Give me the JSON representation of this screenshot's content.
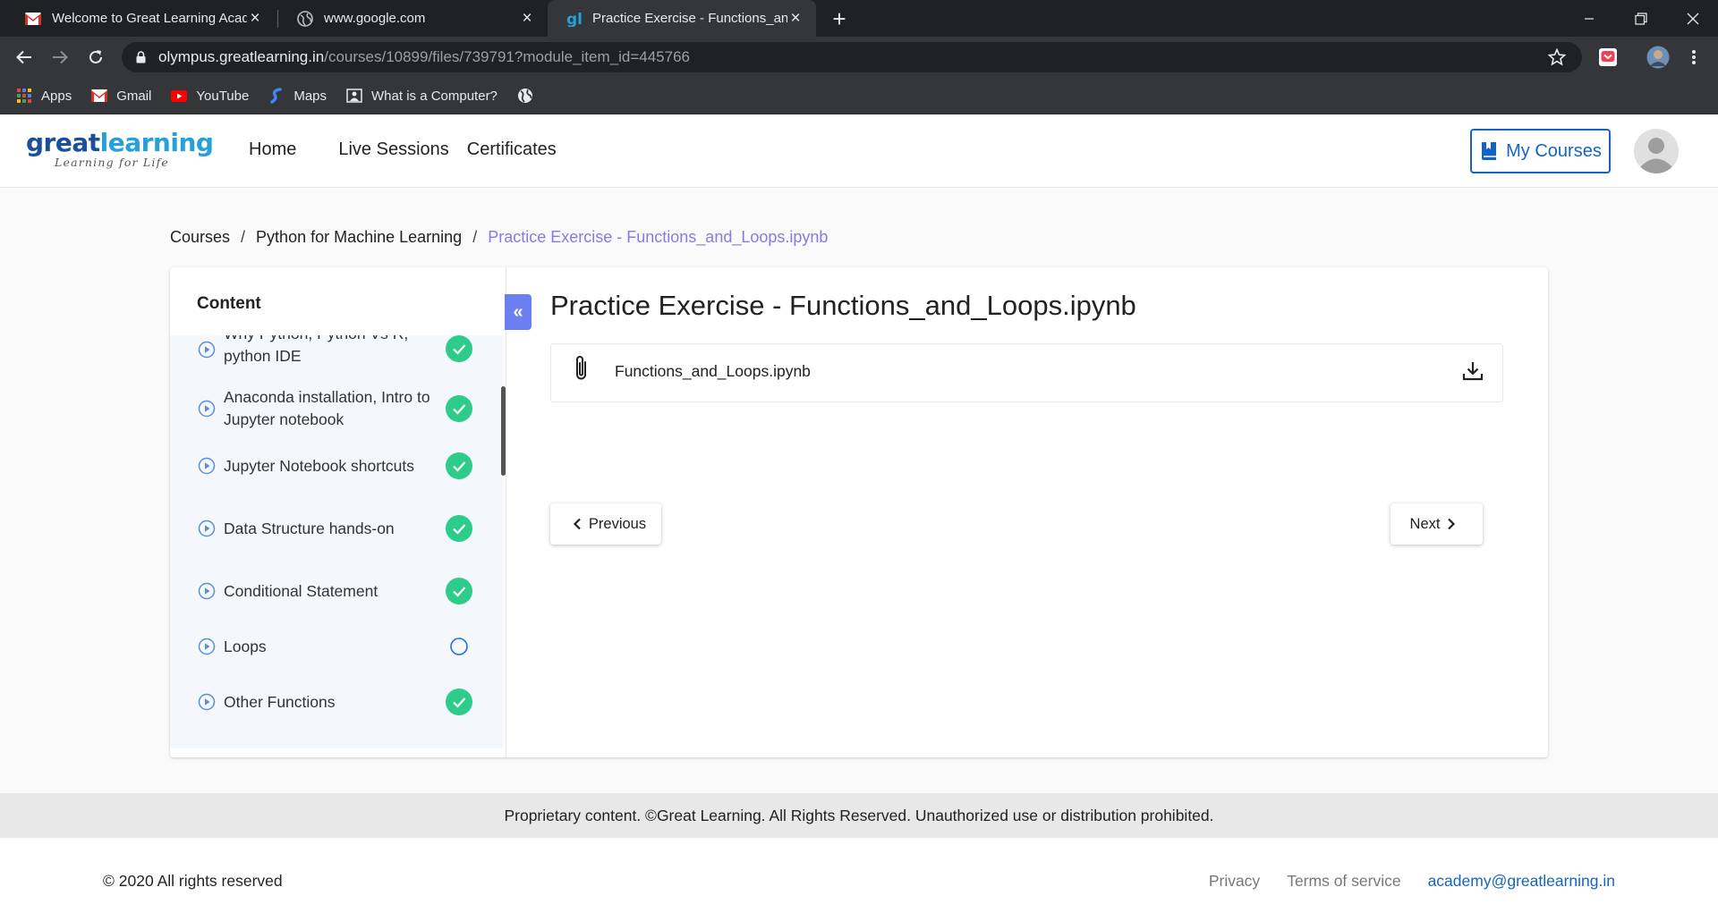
{
  "browser": {
    "tabs": [
      {
        "title": "Welcome to Great Learning Acad",
        "icon": "gmail-icon"
      },
      {
        "title": "www.google.com",
        "icon": "globe-icon"
      },
      {
        "title": "Practice Exercise - Functions_and",
        "icon": "greatlearning-icon"
      }
    ],
    "url_host": "olympus.greatlearning.in",
    "url_path": "/courses/10899/files/739791?module_item_id=445766",
    "bookmarks": [
      {
        "label": "Apps",
        "icon": "apps-grid-icon"
      },
      {
        "label": "Gmail",
        "icon": "gmail-icon"
      },
      {
        "label": "YouTube",
        "icon": "youtube-icon"
      },
      {
        "label": "Maps",
        "icon": "maps-icon"
      },
      {
        "label": "What is a Computer?",
        "icon": "page-icon"
      },
      {
        "label": "",
        "icon": "globe-icon"
      }
    ]
  },
  "header": {
    "logo_great": "great",
    "logo_learning": "learning",
    "logo_tagline": "Learning for Life",
    "nav": [
      "Home",
      "Live Sessions",
      "Certificates"
    ],
    "my_courses": "My Courses",
    "accent": "#1565c0"
  },
  "breadcrumb": {
    "items": [
      "Courses",
      "Python for Machine Learning"
    ],
    "current": "Practice Exercise - Functions_and_Loops.ipynb",
    "separator": "/"
  },
  "sidebar": {
    "title": "Content",
    "items": [
      {
        "label": "Why Python, Python Vs R, python IDE",
        "status": "complete"
      },
      {
        "label": "Anaconda installation, Intro to Jupyter notebook",
        "status": "complete"
      },
      {
        "label": "Jupyter Notebook shortcuts",
        "status": "complete"
      },
      {
        "label": "Data Structure hands-on",
        "status": "complete"
      },
      {
        "label": "Conditional Statement",
        "status": "complete"
      },
      {
        "label": "Loops",
        "status": "incomplete"
      },
      {
        "label": "Other Functions",
        "status": "complete"
      }
    ],
    "complete_color": "#2ecc8a",
    "collapse_symbol": "«"
  },
  "main": {
    "title": "Practice Exercise - Functions_and_Loops.ipynb",
    "file_name": "Functions_and_Loops.ipynb",
    "previous": "Previous",
    "next": "Next"
  },
  "footer": {
    "proprietary": "Proprietary content. ©Great Learning. All Rights Reserved. Unauthorized use or distribution prohibited.",
    "copyright": "© 2020 All rights reserved",
    "links": [
      "Privacy",
      "Terms of service",
      "academy@greatlearning.in"
    ]
  }
}
